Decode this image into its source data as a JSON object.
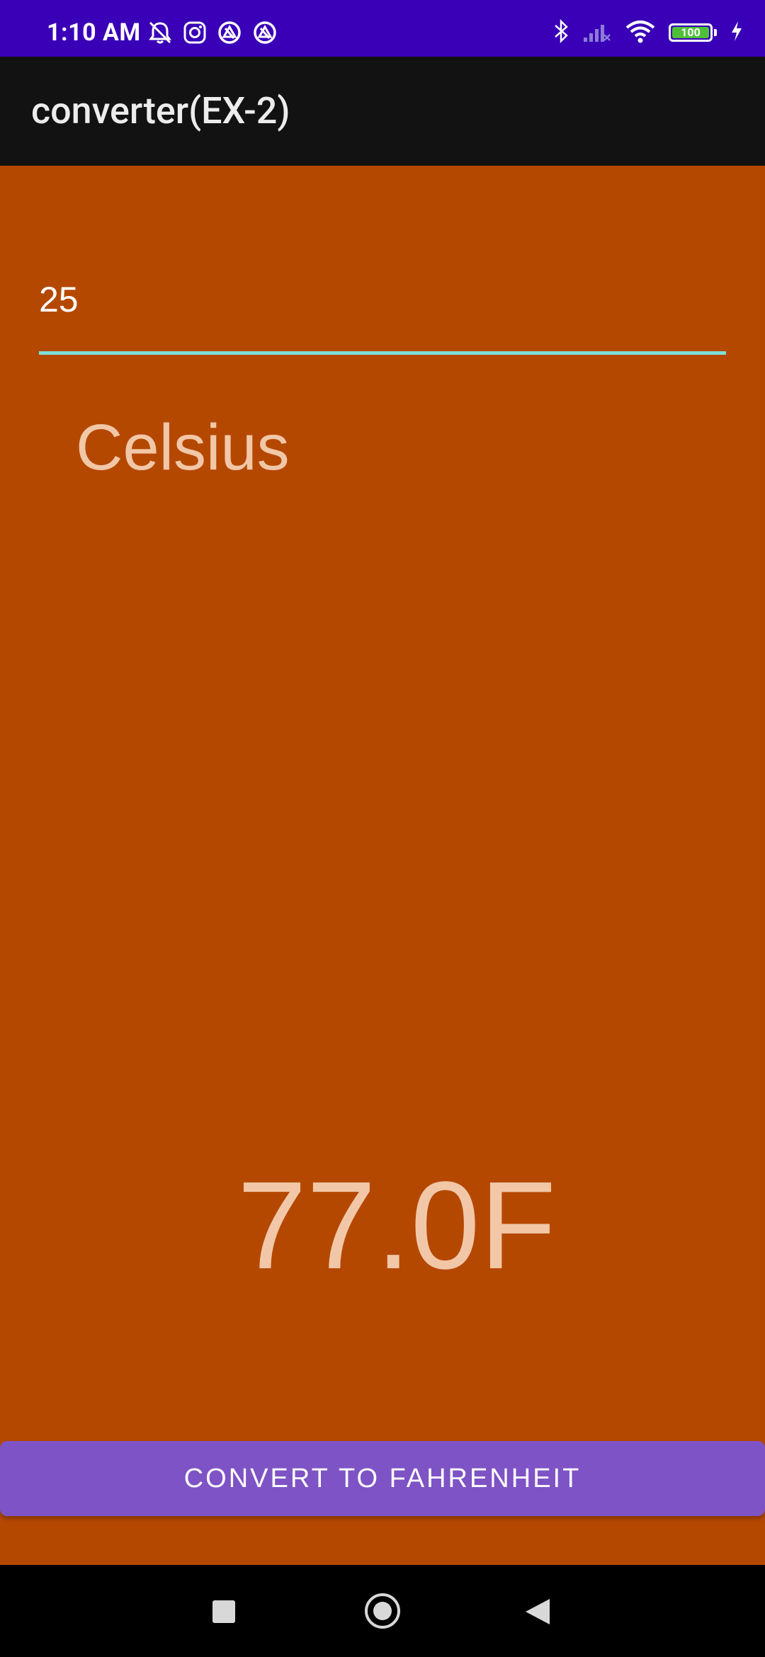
{
  "status_bar": {
    "time": "1:10 AM",
    "battery_level": "100",
    "left_icons": [
      "muted-bell-icon",
      "instagram-icon",
      "app-notification-icon",
      "app-notification-icon"
    ],
    "right_icons": [
      "bluetooth-icon",
      "cellular-signal-off-icon",
      "wifi-icon",
      "battery-icon",
      "charging-bolt-icon"
    ],
    "background_color": "#3900b8"
  },
  "app_bar": {
    "title": "converter(EX-2)",
    "background_color": "#121212"
  },
  "main": {
    "background_color": "#b54800",
    "input": {
      "value": "25",
      "placeholder": ""
    },
    "unit_label": "Celsius",
    "result": "77.0F",
    "accent_underline_color": "#7ee0d9"
  },
  "convert_button": {
    "label": "CONVERT TO FAHRENHEIT",
    "background_color": "#7e53c5"
  },
  "nav_bar": {
    "buttons": [
      "recent-apps-button",
      "home-button",
      "back-button"
    ]
  }
}
